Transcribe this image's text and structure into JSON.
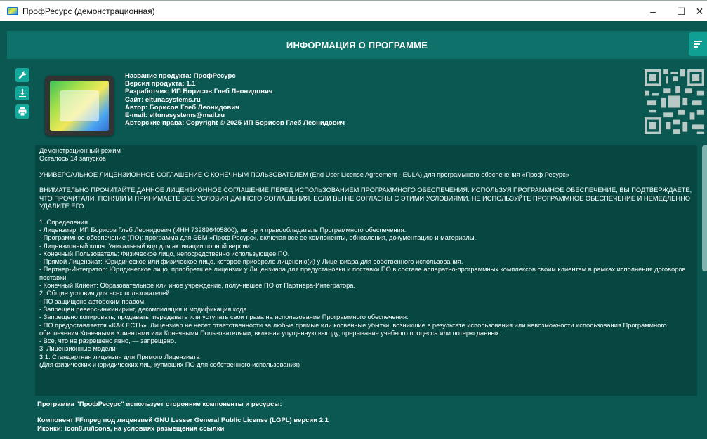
{
  "window": {
    "title": "ПрофРесурс (демонстрационная)",
    "controls": {
      "minimize": "–",
      "maximize": "☐",
      "close": "✕"
    }
  },
  "header": {
    "title": "ИНФОРМАЦИЯ О ПРОГРАММЕ",
    "menu_icon": "filter-menu-icon"
  },
  "toolbar": {
    "buttons": [
      {
        "icon": "wrench-icon"
      },
      {
        "icon": "download-icon"
      },
      {
        "icon": "print-icon"
      }
    ]
  },
  "product": {
    "lines": [
      "Название продукта: ПрофРесурс",
      "Версия продукта: 1.1",
      "Разработчик: ИП Борисов Глеб Леонидович",
      "Сайт: eltunasystems.ru",
      "Автор: Борисов Глеб Леонидович",
      "E-mail: eltunasystems@mail.ru",
      "Авторские права: Copyright © 2025 ИП Борисов Глеб Леонидович"
    ]
  },
  "license": {
    "lines": [
      "Демонстрационный режим",
      "Осталось 14 запусков",
      "",
      "УНИВЕРСАЛЬНОЕ ЛИЦЕНЗИОННОЕ СОГЛАШЕНИЕ С КОНЕЧНЫМ ПОЛЬЗОВАТЕЛЕМ (End User License Agreement - EULA) для программного обеспечения «Проф Ресурс»",
      "",
      "ВНИМАТЕЛЬНО ПРОЧИТАЙТЕ ДАННОЕ ЛИЦЕНЗИОННОЕ СОГЛАШЕНИЕ ПЕРЕД ИСПОЛЬЗОВАНИЕМ ПРОГРАММНОГО ОБЕСПЕЧЕНИЯ. ИСПОЛЬЗУЯ ПРОГРАММНОЕ ОБЕСПЕЧЕНИЕ, ВЫ ПОДТВЕРЖДАЕТЕ, ЧТО ПРОЧИТАЛИ, ПОНЯЛИ И ПРИНИМАЕТЕ ВСЕ УСЛОВИЯ ДАННОГО СОГЛАШЕНИЯ. ЕСЛИ ВЫ НЕ СОГЛАСНЫ С ЭТИМИ УСЛОВИЯМИ, НЕ ИСПОЛЬЗУЙТЕ ПРОГРАММНОЕ ОБЕСПЕЧЕНИЕ И НЕМЕДЛЕННО УДАЛИТЕ ЕГО.",
      "",
      "1. Определения",
      "- Лицензиар: ИП Борисов Глеб Леонидович (ИНН 732896405800), автор и правообладатель Программного обеспечения.",
      "- Программное обеспечение (ПО): программа для ЭВМ «Проф Ресурс», включая все ее компоненты, обновления, документацию и материалы.",
      "- Лицензионный ключ: Уникальный код для активации полной версии.",
      "- Конечный Пользователь: Физическое лицо, непосредственно использующее ПО.",
      "- Прямой Лицензиат: Юридическое или физическое лицо, которое приобрело лицензию(и) у Лицензиара для собственного использования.",
      "- Партнер-Интегратор: Юридическое лицо, приобретшее лицензии у Лицензиара для предустановки и поставки ПО в составе аппаратно-программных комплексов своим клиентам в рамках исполнения договоров поставки.",
      "- Конечный Клиент: Образовательное или иное учреждение, получившее ПО от Партнера-Интегратора.",
      "2. Общие условия для всех пользователей",
      "- ПО защищено авторским правом.",
      "- Запрещен реверс-инжиниринг, декомпиляция и модификация кода.",
      "- Запрещено копировать, продавать, передавать или уступать свои права на использование Программного обеспечения.",
      "- ПО предоставляется «КАК ЕСТЬ». Лицензиар не несет ответственности за любые прямые или косвенные убытки, возникшие в результате использования или невозможности использования Программного обеспечения Конечными Клиентами или Конечными Пользователями, включая упущенную выгоду, прерывание учебного процесса или потерю данных.",
      "- Все, что не разрешено явно, — запрещено.",
      "3. Лицензионные модели",
      "3.1. Стандартная лицензия для Прямого Лицензиата",
      "(Для физических и юридических лиц, купивших ПО для собственного использования)"
    ]
  },
  "footer": {
    "heading": "Программа \"ПрофРесурс\" использует сторонние компоненты и ресурсы:",
    "ffmpeg": "Компонент FFmpeg под лицензией GNU Lesser General Public License (LGPL) версии 2.1",
    "icons": "Иконки: icon8.ru/icons, на условиях размещения ссылки"
  },
  "colors": {
    "background": "#0b5751",
    "header": "#0e726b",
    "accent": "#14a89a",
    "text_area": "#064742"
  }
}
